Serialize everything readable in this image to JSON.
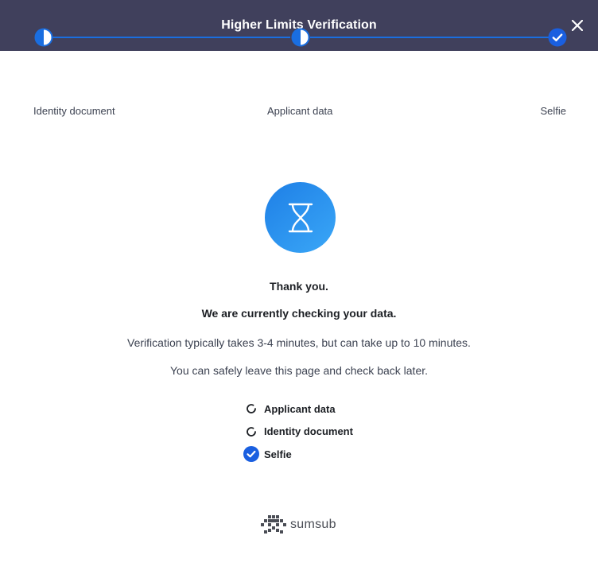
{
  "header": {
    "title": "Higher Limits Verification",
    "close_icon": "close-icon"
  },
  "stepper": {
    "steps": [
      {
        "label": "Identity document",
        "status": "in-progress"
      },
      {
        "label": "Applicant data",
        "status": "in-progress"
      },
      {
        "label": "Selfie",
        "status": "completed"
      }
    ]
  },
  "status": {
    "icon": "hourglass-icon",
    "thank_you": "Thank you.",
    "checking": "We are currently checking your data.",
    "duration": "Verification typically takes 3-4 minutes, but can take up to 10 minutes.",
    "leave": "You can safely leave this page and check back later."
  },
  "checklist": [
    {
      "label": "Applicant data",
      "status": "pending"
    },
    {
      "label": "Identity document",
      "status": "pending"
    },
    {
      "label": "Selfie",
      "status": "completed"
    }
  ],
  "brand": {
    "name": "sumsub"
  },
  "colors": {
    "header_bg": "#40405c",
    "accent": "#1a6ee0",
    "text": "#1c1f24"
  }
}
